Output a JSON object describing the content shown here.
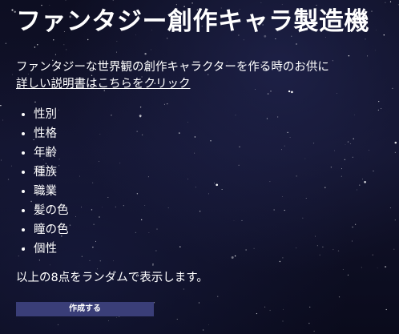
{
  "header": {
    "title": "ファンタジー創作キャラ製造機"
  },
  "intro": {
    "tagline": "ファンタジーな世界観の創作キャラクターを作る時のお供に",
    "link_text": "詳しい説明書はこちらをクリック"
  },
  "attributes": [
    "性別",
    "性格",
    "年齢",
    "種族",
    "職業",
    "髪の色",
    "瞳の色",
    "個性"
  ],
  "summary": "以上の8点をランダムで表示します。",
  "actions": {
    "create_label": "作成する"
  },
  "colors": {
    "background": "#0f1027",
    "button": "#3a3e78",
    "text": "#ffffff"
  }
}
